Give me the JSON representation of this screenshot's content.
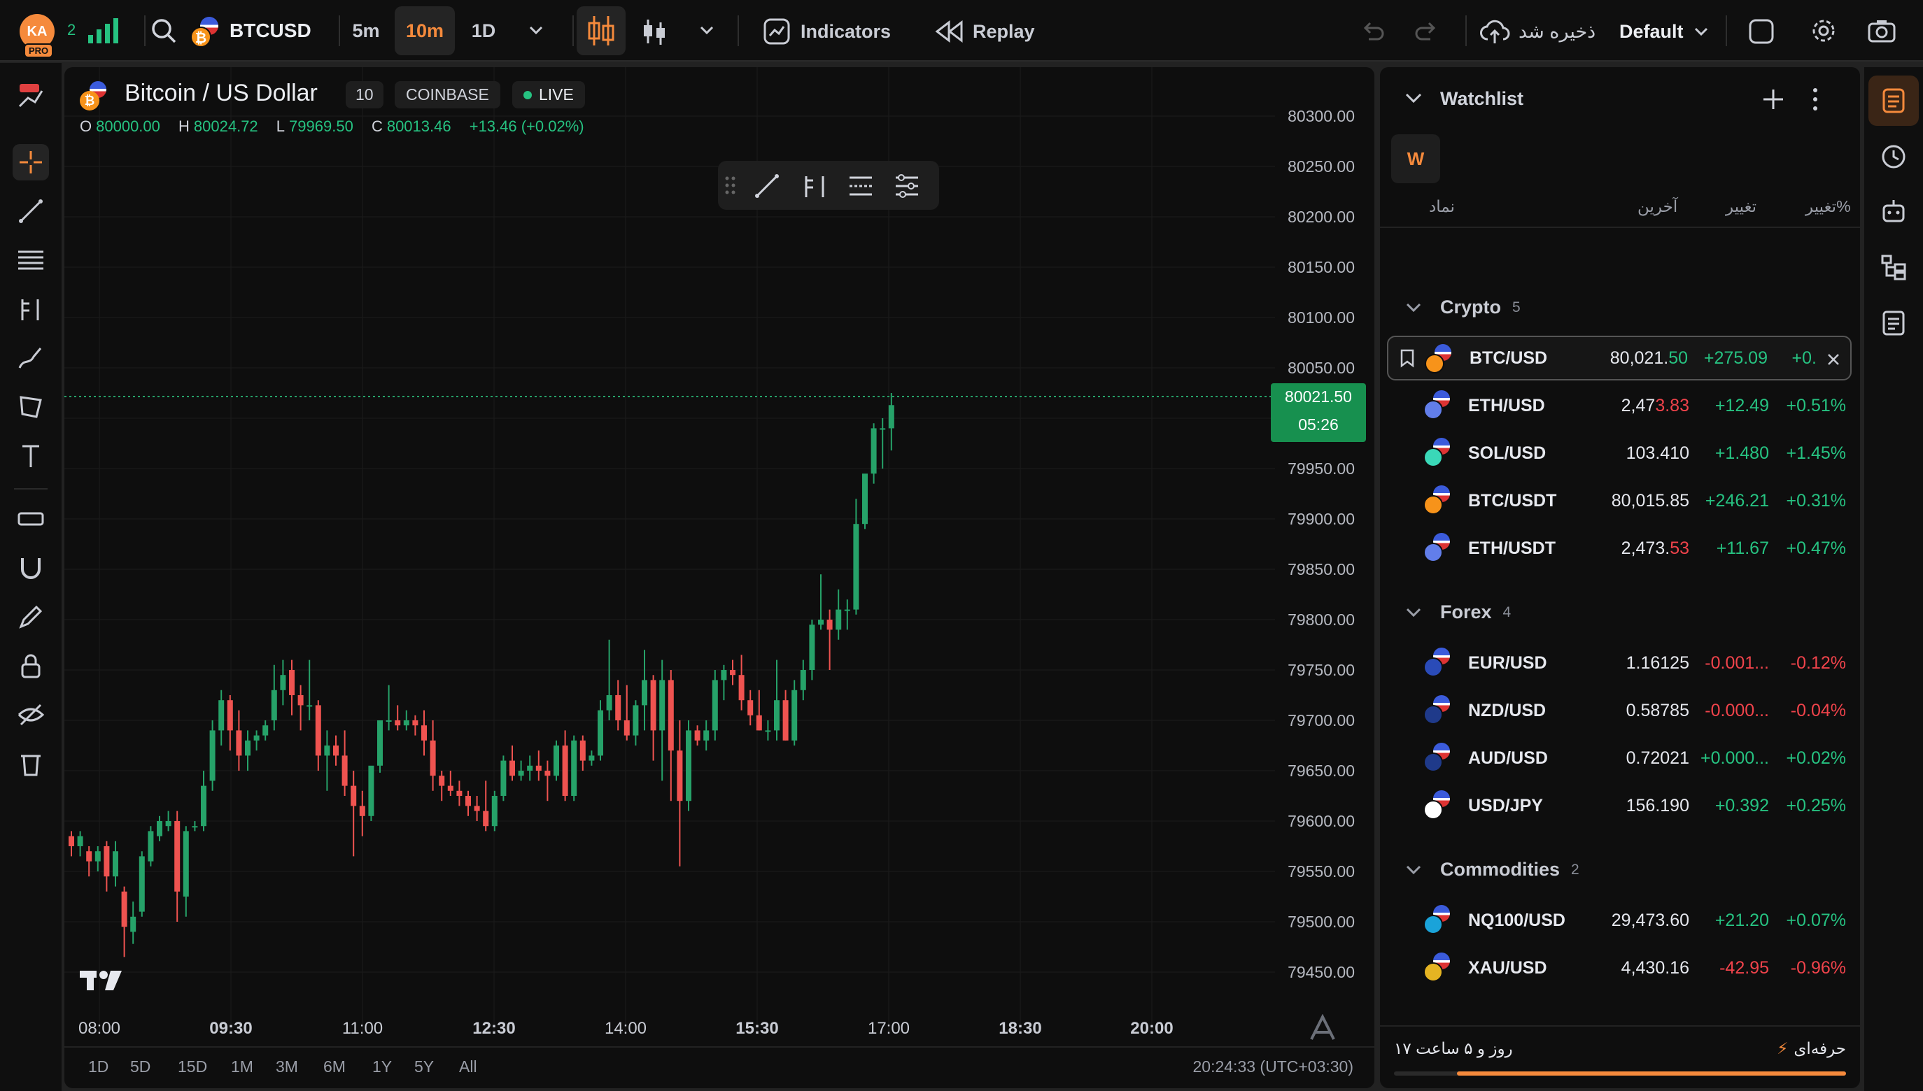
{
  "header": {
    "avatar_initials": "KA",
    "avatar_badge": "PRO",
    "notif_count": "2",
    "symbol": "BTCUSD",
    "timeframes": [
      "5m",
      "10m",
      "1D"
    ],
    "active_timeframe": "10m",
    "indicators_label": "Indicators",
    "replay_label": "Replay",
    "save_label": "ذخیره شد",
    "layout_label": "Default"
  },
  "chart": {
    "title": "Bitcoin / US Dollar",
    "interval_badge": "10",
    "exchange_badge": "COINBASE",
    "live_badge": "LIVE",
    "ohlc": {
      "o_label": "O",
      "o": "80000.00",
      "h_label": "H",
      "h": "80024.72",
      "l_label": "L",
      "l": "79969.50",
      "c_label": "C",
      "c": "80013.46",
      "change": "+13.46 (+0.02%)"
    },
    "last_price": "80021.50",
    "countdown": "05:26",
    "clock": "20:24:33 (UTC+03:30)",
    "ranges": [
      "1D",
      "5D",
      "15D",
      "1M",
      "3M",
      "6M",
      "1Y",
      "5Y",
      "All"
    ],
    "y_ticks": [
      "80300.00",
      "80250.00",
      "80200.00",
      "80150.00",
      "80100.00",
      "80050.00",
      "80000.00",
      "79950.00",
      "79900.00",
      "79850.00",
      "79800.00",
      "79750.00",
      "79700.00",
      "79650.00",
      "79600.00",
      "79550.00",
      "79500.00",
      "79450.00"
    ],
    "x_ticks": [
      {
        "t": "08:00",
        "b": false
      },
      {
        "t": "09:30",
        "b": true
      },
      {
        "t": "11:00",
        "b": false
      },
      {
        "t": "12:30",
        "b": true
      },
      {
        "t": "14:00",
        "b": false
      },
      {
        "t": "15:30",
        "b": true
      },
      {
        "t": "17:00",
        "b": false
      },
      {
        "t": "18:30",
        "b": true
      },
      {
        "t": "20:00",
        "b": true
      }
    ]
  },
  "chart_data": {
    "type": "candlestick",
    "ylim": [
      79430,
      80320
    ],
    "up_color": "#26a269",
    "down_color": "#ef5350",
    "candles": [
      [
        79585,
        79590,
        79565,
        79575
      ],
      [
        79575,
        79590,
        79565,
        79585
      ],
      [
        79570,
        79575,
        79545,
        79560
      ],
      [
        79560,
        79575,
        79550,
        79570
      ],
      [
        79575,
        79580,
        79530,
        79545
      ],
      [
        79545,
        79580,
        79535,
        79570
      ],
      [
        79530,
        79535,
        79465,
        79495
      ],
      [
        79490,
        79520,
        79478,
        79505
      ],
      [
        79510,
        79570,
        79505,
        79565
      ],
      [
        79560,
        79595,
        79555,
        79590
      ],
      [
        79585,
        79605,
        79580,
        79600
      ],
      [
        79595,
        79610,
        79590,
        79600
      ],
      [
        79600,
        79610,
        79500,
        79530
      ],
      [
        79525,
        79595,
        79505,
        79590
      ],
      [
        79595,
        79600,
        79590,
        79595
      ],
      [
        79595,
        79650,
        79590,
        79635
      ],
      [
        79640,
        79700,
        79630,
        79690
      ],
      [
        79690,
        79730,
        79675,
        79720
      ],
      [
        79720,
        79725,
        79670,
        79690
      ],
      [
        79690,
        79710,
        79650,
        79665
      ],
      [
        79665,
        79690,
        79650,
        79680
      ],
      [
        79680,
        79690,
        79670,
        79685
      ],
      [
        79685,
        79700,
        79680,
        79695
      ],
      [
        79700,
        79755,
        79690,
        79730
      ],
      [
        79730,
        79760,
        79715,
        79745
      ],
      [
        79750,
        79760,
        79705,
        79725
      ],
      [
        79725,
        79735,
        79690,
        79715
      ],
      [
        79715,
        79760,
        79700,
        79715
      ],
      [
        79715,
        79720,
        79650,
        79665
      ],
      [
        79665,
        79690,
        79630,
        79675
      ],
      [
        79675,
        79685,
        79655,
        79665
      ],
      [
        79665,
        79690,
        79625,
        79635
      ],
      [
        79635,
        79650,
        79565,
        79615
      ],
      [
        79615,
        79630,
        79585,
        79605
      ],
      [
        79605,
        79640,
        79600,
        79655
      ],
      [
        79655,
        79700,
        79648,
        79700
      ],
      [
        79700,
        79735,
        79690,
        79700
      ],
      [
        79700,
        79715,
        79690,
        79695
      ],
      [
        79695,
        79710,
        79690,
        79700
      ],
      [
        79700,
        79705,
        79685,
        79695
      ],
      [
        79695,
        79710,
        79665,
        79680
      ],
      [
        79680,
        79700,
        79630,
        79645
      ],
      [
        79645,
        79650,
        79620,
        79635
      ],
      [
        79635,
        79650,
        79625,
        79630
      ],
      [
        79630,
        79640,
        79615,
        79625
      ],
      [
        79625,
        79630,
        79605,
        79615
      ],
      [
        79615,
        79625,
        79600,
        79610
      ],
      [
        79610,
        79640,
        79590,
        79595
      ],
      [
        79595,
        79630,
        79590,
        79625
      ],
      [
        79625,
        79665,
        79620,
        79660
      ],
      [
        79660,
        79675,
        79640,
        79645
      ],
      [
        79645,
        79660,
        79640,
        79650
      ],
      [
        79650,
        79665,
        79640,
        79655
      ],
      [
        79655,
        79670,
        79640,
        79650
      ],
      [
        79650,
        79660,
        79620,
        79645
      ],
      [
        79645,
        79680,
        79640,
        79675
      ],
      [
        79675,
        79690,
        79620,
        79625
      ],
      [
        79625,
        79685,
        79620,
        79680
      ],
      [
        79680,
        79685,
        79650,
        79660
      ],
      [
        79660,
        79670,
        79655,
        79665
      ],
      [
        79665,
        79720,
        79660,
        79710
      ],
      [
        79710,
        79780,
        79700,
        79725
      ],
      [
        79725,
        79740,
        79690,
        79700
      ],
      [
        79700,
        79735,
        79680,
        79685
      ],
      [
        79685,
        79720,
        79675,
        79715
      ],
      [
        79715,
        79770,
        79690,
        79740
      ],
      [
        79740,
        79745,
        79660,
        79690
      ],
      [
        79690,
        79760,
        79640,
        79740
      ],
      [
        79740,
        79750,
        79620,
        79670
      ],
      [
        79670,
        79700,
        79555,
        79620
      ],
      [
        79620,
        79700,
        79610,
        79690
      ],
      [
        79690,
        79695,
        79675,
        79680
      ],
      [
        79680,
        79700,
        79670,
        79690
      ],
      [
        79690,
        79750,
        79680,
        79740
      ],
      [
        79740,
        79755,
        79720,
        79750
      ],
      [
        79750,
        79760,
        79735,
        79745
      ],
      [
        79745,
        79765,
        79710,
        79720
      ],
      [
        79720,
        79730,
        79695,
        79705
      ],
      [
        79705,
        79730,
        79690,
        79690
      ],
      [
        79690,
        79700,
        79680,
        79690
      ],
      [
        79690,
        79760,
        79680,
        79720
      ],
      [
        79720,
        79730,
        79680,
        79680
      ],
      [
        79680,
        79740,
        79675,
        79730
      ],
      [
        79730,
        79760,
        79720,
        79750
      ],
      [
        79750,
        79800,
        79740,
        79795
      ],
      [
        79795,
        79845,
        79790,
        79800
      ],
      [
        79800,
        79810,
        79750,
        79790
      ],
      [
        79790,
        79830,
        79780,
        79810
      ],
      [
        79810,
        79820,
        79790,
        79810
      ],
      [
        79810,
        79920,
        79805,
        79895
      ],
      [
        79895,
        79940,
        79890,
        79945
      ],
      [
        79945,
        79995,
        79935,
        79990
      ],
      [
        79990,
        80000,
        79950,
        79990
      ],
      [
        79990,
        80025,
        79968,
        80013
      ]
    ]
  },
  "watchlist": {
    "title": "Watchlist",
    "letter": "W",
    "columns": {
      "symbol": "نماد",
      "last": "آخرین",
      "change": "تغییر",
      "pct": "تغییر%"
    },
    "sections": [
      {
        "name": "Crypto",
        "count": "5",
        "rows": [
          {
            "sym": "BTC/USD",
            "last_a": "80,021.",
            "last_b": "50",
            "chg": "+275.09",
            "pct": "+0.",
            "icon": "btc",
            "sel": true
          },
          {
            "sym": "ETH/USD",
            "last_a": "2,47",
            "last_b": "3.83",
            "chg": "+12.49",
            "pct": "+0.51%",
            "icon": "eth",
            "neg_tail": true
          },
          {
            "sym": "SOL/USD",
            "last_a": "103.410",
            "last_b": "",
            "chg": "+1.480",
            "pct": "+1.45%",
            "icon": "sol"
          },
          {
            "sym": "BTC/USDT",
            "last_a": "80,015.85",
            "last_b": "",
            "chg": "+246.21",
            "pct": "+0.31%",
            "icon": "btc"
          },
          {
            "sym": "ETH/USDT",
            "last_a": "2,473.",
            "last_b": "53",
            "chg": "+11.67",
            "pct": "+0.47%",
            "icon": "eth",
            "neg_tail": true
          }
        ]
      },
      {
        "name": "Forex",
        "count": "4",
        "rows": [
          {
            "sym": "EUR/USD",
            "last_a": "1.16125",
            "last_b": "",
            "chg": "-0.001...",
            "pct": "-0.12%",
            "icon": "eur",
            "neg": true
          },
          {
            "sym": "NZD/USD",
            "last_a": "0.58785",
            "last_b": "",
            "chg": "-0.000...",
            "pct": "-0.04%",
            "icon": "nzd",
            "neg": true
          },
          {
            "sym": "AUD/USD",
            "last_a": "0.72021",
            "last_b": "",
            "chg": "+0.000...",
            "pct": "+0.02%",
            "icon": "aud"
          },
          {
            "sym": "USD/JPY",
            "last_a": "156.190",
            "last_b": "",
            "chg": "+0.392",
            "pct": "+0.25%",
            "icon": "jpy"
          }
        ]
      },
      {
        "name": "Commodities",
        "count": "2",
        "rows": [
          {
            "sym": "NQ100/USD",
            "last_a": "29,473.60",
            "last_b": "",
            "chg": "+21.20",
            "pct": "+0.07%",
            "icon": "nq"
          },
          {
            "sym": "XAU/USD",
            "last_a": "4,430.16",
            "last_b": "",
            "chg": "-42.95",
            "pct": "-0.96%",
            "icon": "xau",
            "neg": true
          }
        ]
      }
    ],
    "footer_plan": "حرفه‌ای",
    "footer_remaining": "۱۷ روز و ۵ ساعت"
  }
}
